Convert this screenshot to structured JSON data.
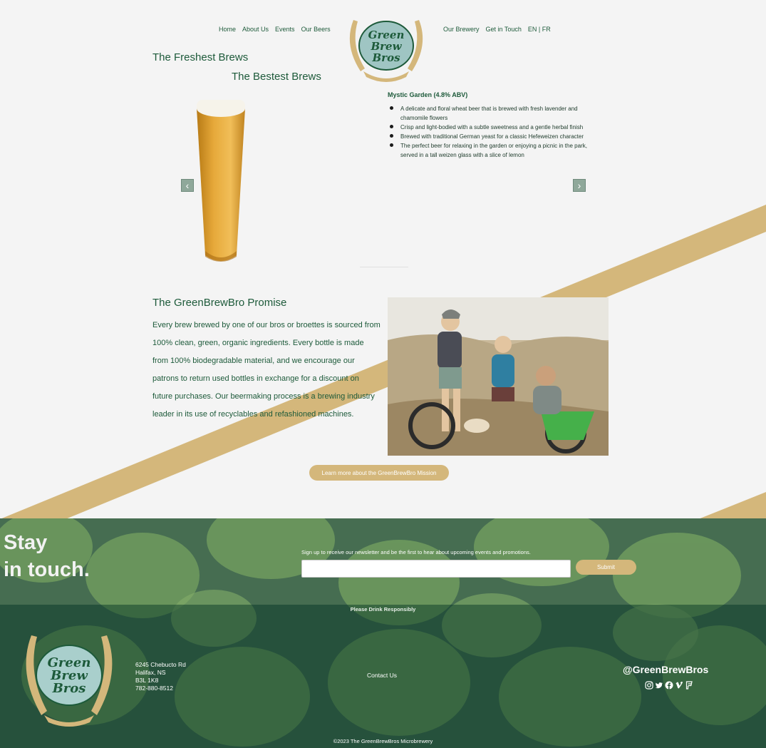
{
  "nav": {
    "left_items": [
      "Home",
      "About Us",
      "Events",
      "Our Beers"
    ],
    "right_items": [
      "Our Brewery",
      "Get in Touch"
    ],
    "language": "EN | FR"
  },
  "logo": {
    "line1": "Green",
    "line2": "Brew",
    "line3": "Bros"
  },
  "hero": {
    "title": "The Freshest Brews",
    "subtitle": "The Bestest Brews"
  },
  "featured_beer": {
    "name": "Mystic Garden (4.8% ABV)",
    "points": [
      "A delicate and floral wheat beer that is brewed with fresh lavender and chamomile flowers",
      "Crisp and light-bodied with a subtle sweetness and a gentle herbal finish",
      "Brewed with traditional German yeast for a classic Hefeweizen character",
      "The perfect beer for relaxing in the garden or enjoying a picnic in the park, served in a tall weizen glass with a slice of lemon"
    ]
  },
  "promise": {
    "title": "The GreenBrewBro Promise",
    "text": "Every brew brewed by one of our bros or broettes is sourced from 100% clean, green, organic ingredients. Every bottle is made from 100% biodegradable material, and we encourage our patrons to return used bottles in exchange for a discount on future purchases. Our beermaking process is a brewing industry leader in its use of recyclables and refashioned machines.",
    "button": "Learn more about the GreenBrewBro Mission"
  },
  "newsletter": {
    "title_line1": "Stay",
    "title_line2": "in touch.",
    "label": "Sign up to receive our newsletter and be the first to hear about upcoming events and promotions.",
    "email_value": "",
    "submit": "Submit"
  },
  "footer": {
    "notice": "Please Drink Responsibly",
    "address": [
      "6245 Chebucto Rd",
      "Halifax, NS",
      "B3L 1K8",
      "782-880-8512"
    ],
    "contact": "Contact Us",
    "handle": "@GreenBrewBros",
    "socials": [
      "instagram-icon",
      "twitter-icon",
      "facebook-icon",
      "vimeo-icon",
      "foursquare-icon"
    ],
    "copyright": "©2023 The GreenBrewBros Microbrewery"
  },
  "colors": {
    "brand_green": "#1d5a3a",
    "gold": "#d4b77b",
    "background": "#f4f4f4"
  }
}
